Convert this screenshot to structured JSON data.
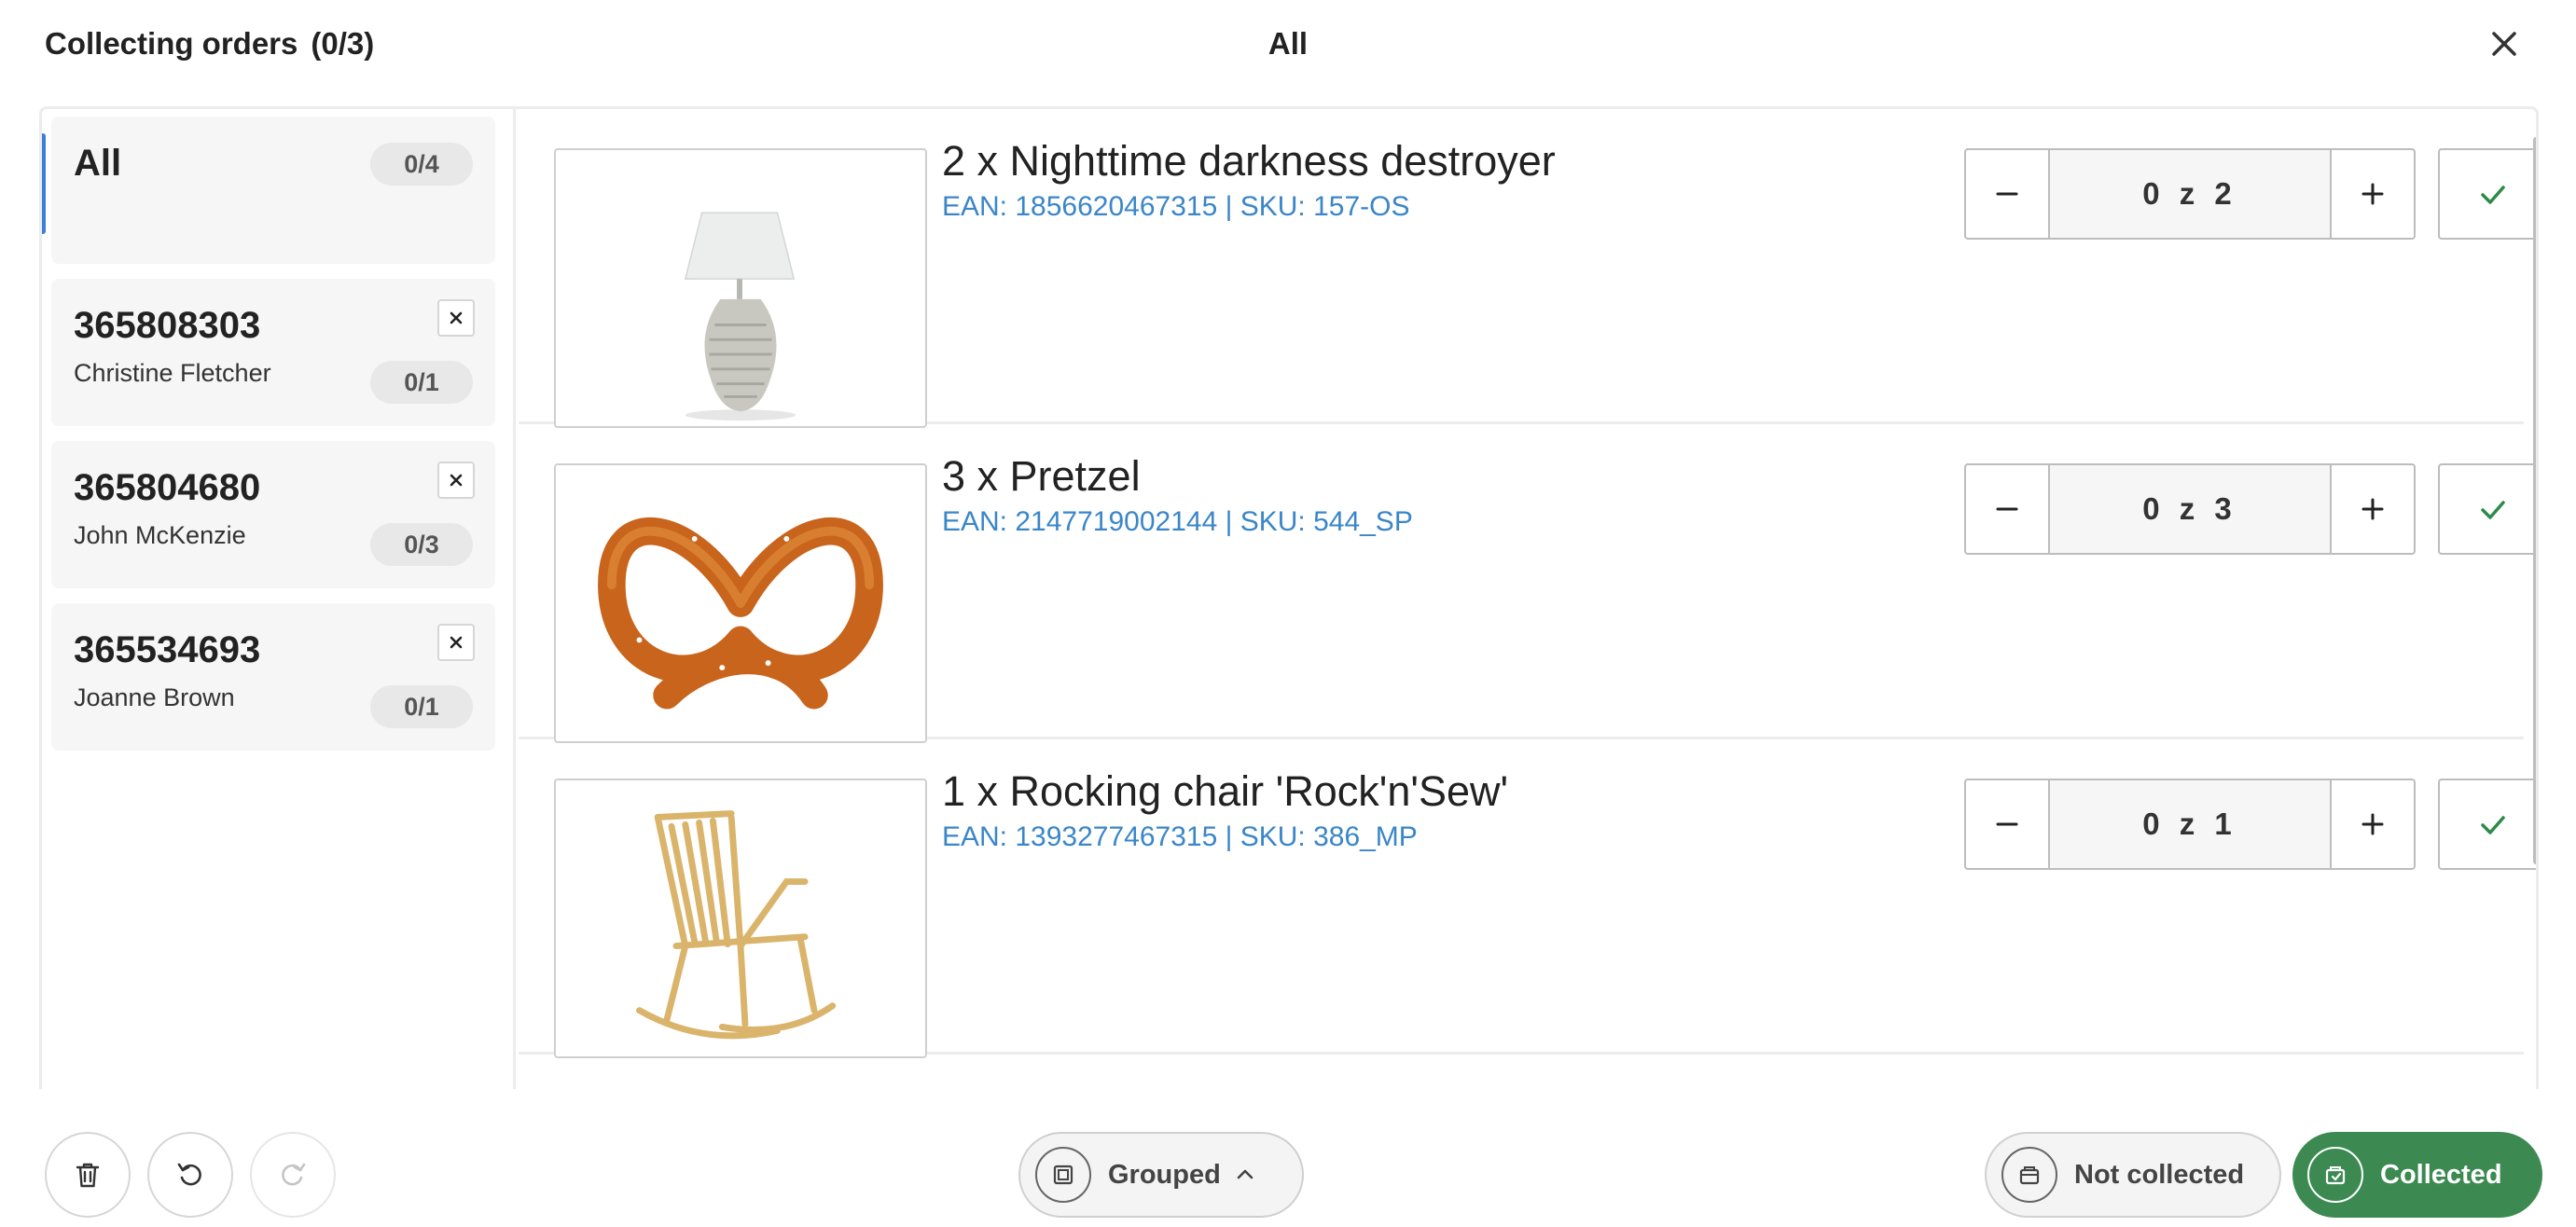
{
  "header": {
    "title": "Collecting orders",
    "count": "(0/3)",
    "center_title": "All",
    "close_icon": "close-icon"
  },
  "sidebar": {
    "orders": [
      {
        "title": "All",
        "name": "",
        "progress": "0/4",
        "active": true,
        "removable": false
      },
      {
        "title": "365808303",
        "name": "Christine Fletcher",
        "progress": "0/1",
        "active": false,
        "removable": true
      },
      {
        "title": "365804680",
        "name": "John McKenzie",
        "progress": "0/3",
        "active": false,
        "removable": true
      },
      {
        "title": "365534693",
        "name": "Joanne Brown",
        "progress": "0/1",
        "active": false,
        "removable": true
      }
    ]
  },
  "items": [
    {
      "name": "2 x Nighttime darkness destroyer",
      "codes": "EAN: 1856620467315 | SKU: 157-OS",
      "quantity": "0 z 2",
      "image": "table-lamp"
    },
    {
      "name": "3 x Pretzel",
      "codes": "EAN: 2147719002144 | SKU: 544_SP",
      "quantity": "0 z 3",
      "image": "pretzel"
    },
    {
      "name": "1 x Rocking chair 'Rock'n'Sew'",
      "codes": "EAN: 1393277467315 | SKU: 386_MP",
      "quantity": "0 z 1",
      "image": "rocking-chair"
    }
  ],
  "footer": {
    "delete_icon": "trash-icon",
    "undo_icon": "undo-icon",
    "redo_icon": "redo-icon",
    "grouped_label": "Grouped",
    "not_collected_label": "Not collected",
    "collected_label": "Collected"
  },
  "colors": {
    "accent_blue": "#3b7fd9",
    "link_blue": "#3a86c8",
    "collected_green": "#3c8a52",
    "check_green": "#2e8a48"
  }
}
